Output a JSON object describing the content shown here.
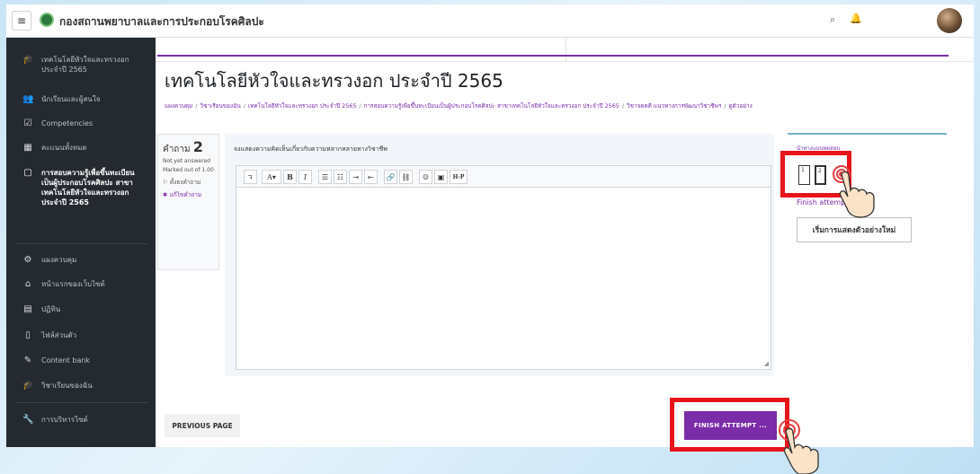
{
  "header": {
    "menu_icon": "hamburger-icon",
    "site_name": "กองสถานพยาบาลและการประกอบโรคศิลปะ",
    "search_icon": "search-icon",
    "notification_icon": "bell-icon"
  },
  "sidebar": {
    "items": [
      {
        "icon": "graduation-cap-icon",
        "glyph": "🎓",
        "label": "เทคโนโลยีหัวใจและทรวงอก ประจำปี 2565"
      },
      {
        "icon": "users-icon",
        "glyph": "👥",
        "label": "นักเรียนและผู้สนใจ"
      },
      {
        "icon": "checkbox-icon",
        "glyph": "☑",
        "label": "Competencies"
      },
      {
        "icon": "grid-icon",
        "glyph": "▦",
        "label": "คะแนนทั้งหมด"
      },
      {
        "icon": "folder-icon",
        "glyph": "▢",
        "label": "การสอบความรู้เพื่อขึ้นทะเบียนเป็นผู้ประกอบโรคศิลปะ สาขาเทคโนโลยีหัวใจและทรวงอก ประจำปี 2565"
      },
      {
        "icon": "dashboard-icon",
        "glyph": "⚙",
        "label": "แผงควบคุม"
      },
      {
        "icon": "home-icon",
        "glyph": "⌂",
        "label": "หน้าแรกของเว็บไซต์"
      },
      {
        "icon": "calendar-icon",
        "glyph": "▤",
        "label": "ปฏิทิน"
      },
      {
        "icon": "file-icon",
        "glyph": "▯",
        "label": "ไฟล์ส่วนตัว"
      },
      {
        "icon": "pen-icon",
        "glyph": "✎",
        "label": "Content bank"
      },
      {
        "icon": "graduation-cap-icon",
        "glyph": "🎓",
        "label": "วิชาเรียนของฉัน"
      },
      {
        "icon": "wrench-icon",
        "glyph": "🔧",
        "label": "การบริหารไซต์"
      }
    ]
  },
  "main": {
    "title": "เทคโนโลยีหัวใจและทรวงอก ประจำปี 2565",
    "breadcrumb": [
      "แผงควบคุม",
      "วิชาเรียนของฉัน",
      "เทคโนโลยีหัวใจและทรวงอก ประจำปี 2565",
      "การสอบความรู้เพื่อขึ้นทะเบียนเป็นผู้ประกอบโรคศิลปะ สาขาเทคโนโลยีหัวใจและทรวงอก ประจำปี 2565",
      "วิชาจดคดี แนวทางการพัฒนาวิชาชีพฯ",
      "ดูตัวอย่าง"
    ]
  },
  "question": {
    "label": "คำถาม",
    "number": "2",
    "status": "Not yet answered",
    "marks": "Marked out of 1.00",
    "flag": "ตั้งธงคำถาม",
    "edit": "แก้ไขคำถาม",
    "text": "จงแสดงความคิดเห็นเกี่ยวกับความหลากหลายทางวิชาชีพ"
  },
  "editor": {
    "buttons": [
      "↴",
      "A▾",
      "B",
      "I",
      "☰",
      "☷",
      "⇥",
      "⇤",
      "🔗",
      "⛓",
      "☺",
      "▣",
      "H-P"
    ],
    "content": ""
  },
  "nav": {
    "title": "นำทางแบบทดสอบ",
    "boxes": [
      "1",
      "2"
    ],
    "finish_link": "Finish attempt ...",
    "restart": "เริ่มการแสดงตัวอย่างใหม่"
  },
  "footer": {
    "previous": "PREVIOUS PAGE",
    "finish": "FINISH ATTEMPT ..."
  },
  "colors": {
    "accent": "#7b2ca8",
    "sidebar_bg": "#252a31",
    "highlight": "#e8131b"
  }
}
